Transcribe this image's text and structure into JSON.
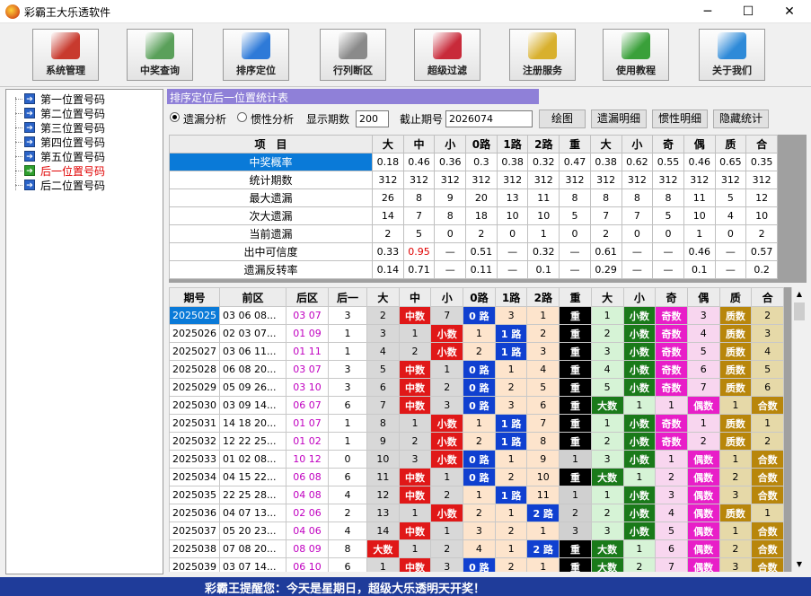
{
  "window": {
    "title": "彩霸王大乐透软件",
    "min": "─",
    "max": "☐",
    "close": "✕"
  },
  "toolbar": [
    {
      "label": "系统管理",
      "icon": "toolbox-icon",
      "color": "#c83a2e"
    },
    {
      "label": "中奖查询",
      "icon": "money-icon",
      "color": "#5aa05a"
    },
    {
      "label": "排序定位",
      "icon": "compass-icon",
      "color": "#2e7ad8"
    },
    {
      "label": "行列断区",
      "icon": "grid-icon",
      "color": "#8a8a8a"
    },
    {
      "label": "超级过滤",
      "icon": "filter-icon",
      "color": "#c82a3a"
    },
    {
      "label": "注册服务",
      "icon": "key-icon",
      "color": "#d8b02e"
    },
    {
      "label": "使用教程",
      "icon": "person-icon",
      "color": "#3aa03a"
    },
    {
      "label": "关于我们",
      "icon": "phone-icon",
      "color": "#2e8ad8"
    }
  ],
  "tree": [
    {
      "label": "第一位置号码",
      "selected": false
    },
    {
      "label": "第二位置号码",
      "selected": false
    },
    {
      "label": "第三位置号码",
      "selected": false
    },
    {
      "label": "第四位置号码",
      "selected": false
    },
    {
      "label": "第五位置号码",
      "selected": false
    },
    {
      "label": "后一位置号码",
      "selected": true
    },
    {
      "label": "后二位置号码",
      "selected": false
    }
  ],
  "panel": {
    "header": "排序定位后一位置统计表",
    "radio1": "遗漏分析",
    "radio2": "惯性分析",
    "periods_label": "显示期数",
    "periods_value": "200",
    "cutoff_label": "截止期号",
    "cutoff_value": "2026074",
    "btn_draw": "绘图",
    "btn_miss": "遗漏明细",
    "btn_inertia": "惯性明细",
    "btn_hide": "隐藏统计"
  },
  "stats": {
    "headers": [
      "项　目",
      "大",
      "中",
      "小",
      "0路",
      "1路",
      "2路",
      "重",
      "大",
      "小",
      "奇",
      "偶",
      "质",
      "合"
    ],
    "rows": [
      {
        "label": "中奖概率",
        "values": [
          "0.18",
          "0.46",
          "0.36",
          "0.3",
          "0.38",
          "0.32",
          "0.47",
          "0.38",
          "0.62",
          "0.55",
          "0.46",
          "0.65",
          "0.35"
        ]
      },
      {
        "label": "统计期数",
        "values": [
          "312",
          "312",
          "312",
          "312",
          "312",
          "312",
          "312",
          "312",
          "312",
          "312",
          "312",
          "312",
          "312"
        ]
      },
      {
        "label": "最大遗漏",
        "values": [
          "26",
          "8",
          "9",
          "20",
          "13",
          "11",
          "8",
          "8",
          "8",
          "8",
          "11",
          "5",
          "12"
        ]
      },
      {
        "label": "次大遗漏",
        "values": [
          "14",
          "7",
          "8",
          "18",
          "10",
          "10",
          "5",
          "7",
          "7",
          "5",
          "10",
          "4",
          "10"
        ]
      },
      {
        "label": "当前遗漏",
        "values": [
          "2",
          "5",
          "0",
          "2",
          "0",
          "1",
          "0",
          "2",
          "0",
          "0",
          "1",
          "0",
          "2"
        ]
      },
      {
        "label": "出中可信度",
        "values": [
          "0.33",
          "0.95",
          "—",
          "0.51",
          "—",
          "0.32",
          "—",
          "0.61",
          "—",
          "—",
          "0.46",
          "—",
          "0.57"
        ]
      },
      {
        "label": "遗漏反转率",
        "values": [
          "0.14",
          "0.71",
          "—",
          "0.11",
          "—",
          "0.1",
          "—",
          "0.29",
          "—",
          "—",
          "0.1",
          "—",
          "0.2"
        ]
      }
    ]
  },
  "grid": {
    "headers": [
      "期号",
      "前区",
      "后区",
      "后一",
      "大",
      "中",
      "小",
      "0路",
      "1路",
      "2路",
      "重",
      "大",
      "小",
      "奇",
      "偶",
      "质",
      "合"
    ],
    "rows": [
      [
        "2025025",
        "03 06 08...",
        "03 07",
        "3",
        "2",
        "中数",
        "7",
        "0 路",
        "3",
        "1",
        "重",
        "1",
        "小数",
        "奇数",
        "3",
        "质数",
        "2"
      ],
      [
        "2025026",
        "02 03 07...",
        "01 09",
        "1",
        "3",
        "1",
        "小数",
        "1",
        "1 路",
        "2",
        "重",
        "2",
        "小数",
        "奇数",
        "4",
        "质数",
        "3"
      ],
      [
        "2025027",
        "03 06 11...",
        "01 11",
        "1",
        "4",
        "2",
        "小数",
        "2",
        "1 路",
        "3",
        "重",
        "3",
        "小数",
        "奇数",
        "5",
        "质数",
        "4"
      ],
      [
        "2025028",
        "06 08 20...",
        "03 07",
        "3",
        "5",
        "中数",
        "1",
        "0 路",
        "1",
        "4",
        "重",
        "4",
        "小数",
        "奇数",
        "6",
        "质数",
        "5"
      ],
      [
        "2025029",
        "05 09 26...",
        "03 10",
        "3",
        "6",
        "中数",
        "2",
        "0 路",
        "2",
        "5",
        "重",
        "5",
        "小数",
        "奇数",
        "7",
        "质数",
        "6"
      ],
      [
        "2025030",
        "03 09 14...",
        "06 07",
        "6",
        "7",
        "中数",
        "3",
        "0 路",
        "3",
        "6",
        "重",
        "大数",
        "1",
        "1",
        "偶数",
        "1",
        "合数"
      ],
      [
        "2025031",
        "14 18 20...",
        "01 07",
        "1",
        "8",
        "1",
        "小数",
        "1",
        "1 路",
        "7",
        "重",
        "1",
        "小数",
        "奇数",
        "1",
        "质数",
        "1"
      ],
      [
        "2025032",
        "12 22 25...",
        "01 02",
        "1",
        "9",
        "2",
        "小数",
        "2",
        "1 路",
        "8",
        "重",
        "2",
        "小数",
        "奇数",
        "2",
        "质数",
        "2"
      ],
      [
        "2025033",
        "01 02 08...",
        "10 12",
        "0",
        "10",
        "3",
        "小数",
        "0 路",
        "1",
        "9",
        "1",
        "3",
        "小数",
        "1",
        "偶数",
        "1",
        "合数"
      ],
      [
        "2025034",
        "04 15 22...",
        "06 08",
        "6",
        "11",
        "中数",
        "1",
        "0 路",
        "2",
        "10",
        "重",
        "大数",
        "1",
        "2",
        "偶数",
        "2",
        "合数"
      ],
      [
        "2025035",
        "22 25 28...",
        "04 08",
        "4",
        "12",
        "中数",
        "2",
        "1",
        "1 路",
        "11",
        "1",
        "1",
        "小数",
        "3",
        "偶数",
        "3",
        "合数"
      ],
      [
        "2025036",
        "04 07 13...",
        "02 06",
        "2",
        "13",
        "1",
        "小数",
        "2",
        "1",
        "2 路",
        "2",
        "2",
        "小数",
        "4",
        "偶数",
        "质数",
        "1"
      ],
      [
        "2025037",
        "05 20 23...",
        "04 06",
        "4",
        "14",
        "中数",
        "1",
        "3",
        "2",
        "1",
        "3",
        "3",
        "小数",
        "5",
        "偶数",
        "1",
        "合数"
      ],
      [
        "2025038",
        "07 08 20...",
        "08 09",
        "8",
        "大数",
        "1",
        "2",
        "4",
        "1",
        "2 路",
        "重",
        "大数",
        "1",
        "6",
        "偶数",
        "2",
        "合数"
      ],
      [
        "2025039",
        "03 07 14...",
        "06 10",
        "6",
        "1",
        "中数",
        "3",
        "0 路",
        "2",
        "1",
        "重",
        "大数",
        "2",
        "7",
        "偶数",
        "3",
        "合数"
      ]
    ]
  },
  "status": "彩霸王提醒您：今天是星期日，超级大乐透明天开奖！"
}
